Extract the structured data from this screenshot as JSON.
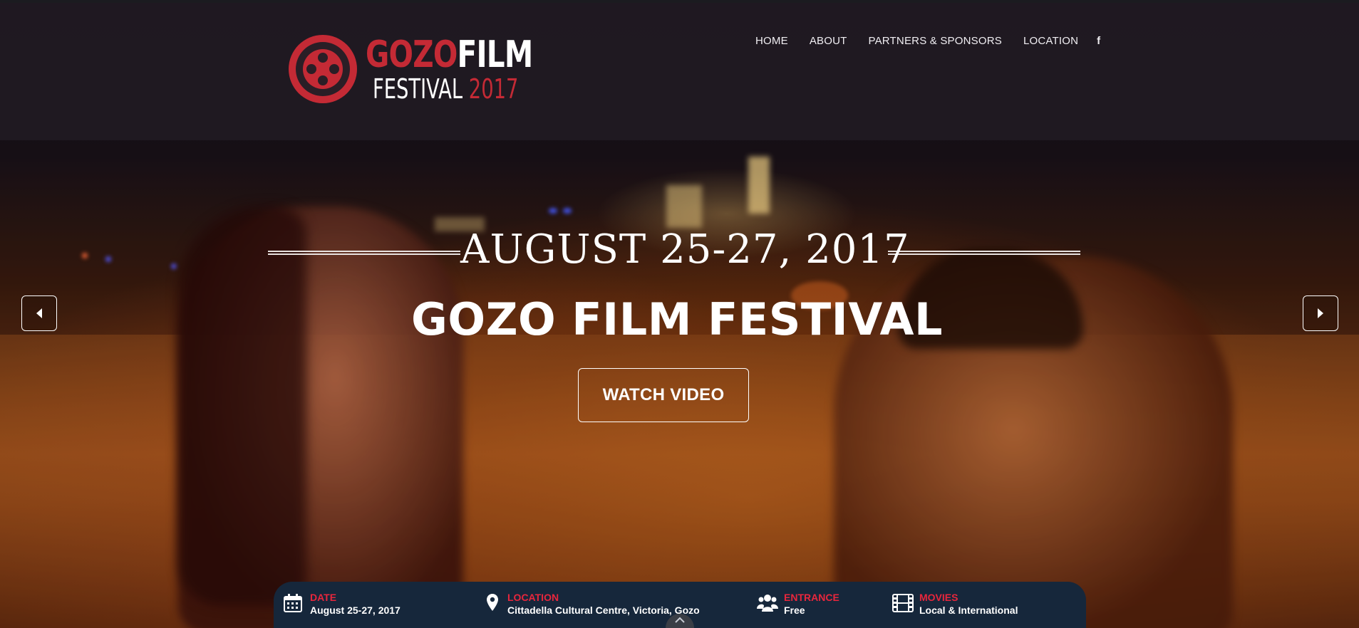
{
  "header": {
    "logo": {
      "line1_red": "GOZO",
      "line1_white": "FILM",
      "line2_white": "FESTIVAL",
      "line2_red": "2017"
    },
    "nav": [
      {
        "label": "HOME"
      },
      {
        "label": "ABOUT"
      },
      {
        "label": "PARTNERS & SPONSORS"
      },
      {
        "label": "LOCATION"
      },
      {
        "label": "f",
        "icon": "facebook-icon"
      }
    ]
  },
  "hero": {
    "date": "AUGUST 25-27, 2017",
    "title": "GOZO FILM FESTIVAL",
    "button_label": "WATCH VIDEO",
    "prev_icon": "chevron-left-icon",
    "next_icon": "chevron-right-icon"
  },
  "info_bar": {
    "items": [
      {
        "icon": "calendar-icon",
        "label": "DATE",
        "value": "August 25-27, 2017"
      },
      {
        "icon": "map-pin-icon",
        "label": "LOCATION",
        "value": "Cittadella Cultural Centre, Victoria, Gozo"
      },
      {
        "icon": "people-icon",
        "label": "ENTRANCE",
        "value": "Free"
      },
      {
        "icon": "film-icon",
        "label": "MOVIES",
        "value": "Local & International"
      }
    ],
    "scroll_icon": "chevron-up-icon"
  },
  "colors": {
    "brand_red": "#c42a35",
    "info_label_red": "#e8263c",
    "info_bar_bg": "#16273b",
    "header_bg": "#201a22"
  }
}
